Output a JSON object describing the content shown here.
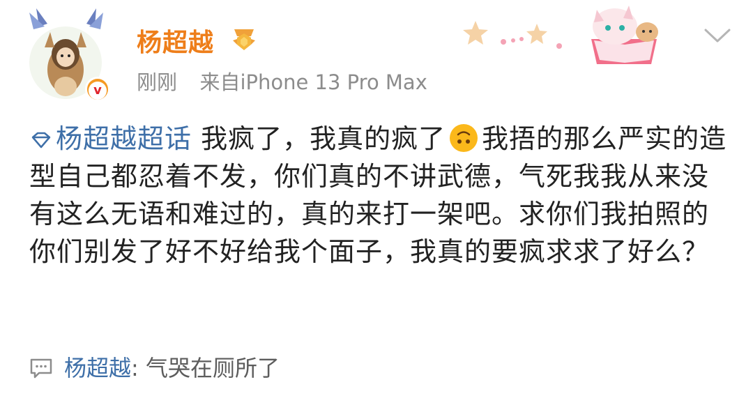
{
  "user": {
    "name": "杨超越",
    "verified_label": "v"
  },
  "meta": {
    "time": "刚刚",
    "source": "来自iPhone 13 Pro Max"
  },
  "post": {
    "topic": "杨超越超话",
    "line1_a": "我疯了，我真的疯了",
    "line1_b": "我捂的那么严实的造型自己都忍着不发，你们真的不讲武德，气死我我从来没有这么无语和难过的，真的来打一架吧。求你们我拍照的你们别发了好不好给我个面子，我真的要疯求求了好么？"
  },
  "comment": {
    "author": "杨超越",
    "text": ": 气哭在厕所了"
  },
  "icons": {
    "topic": "diamond-topic-icon",
    "emoji": "upside-down-face-emoji",
    "menu": "chevron-down-icon",
    "comment": "comment-bubble-icon",
    "badge": "vip-medal-icon"
  },
  "colors": {
    "username": "#ee7e1a",
    "link": "#3e6fa8",
    "meta": "#8c8c8c",
    "text": "#222222"
  }
}
